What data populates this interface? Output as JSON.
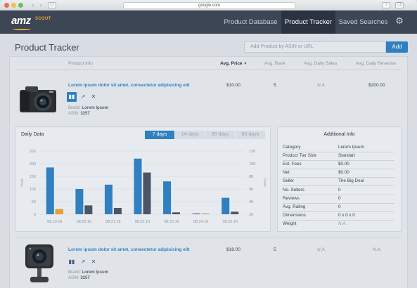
{
  "browser": {
    "url": "google.com"
  },
  "header": {
    "logo_text": "amz",
    "logo_sub": "SCOUT",
    "nav": [
      "Product Database",
      "Product Tracker",
      "Saved Searches"
    ],
    "active_index": 1
  },
  "page": {
    "title": "Product Tracker",
    "add_placeholder": "Add Product by ASIN or URL",
    "add_button": "Add"
  },
  "columns": {
    "product_info": "Product Info",
    "avg_price": "Avg. Price",
    "avg_rank": "Avg. Rank",
    "avg_daily_sales": "Avg. Daily Sales",
    "avg_daily_revenue": "Avg. Daily Revenue"
  },
  "products": [
    {
      "title": "Lorem ipsum dolor sit amet, consectetur adipisicing elit",
      "brand_label": "Brand:",
      "brand": "Lorem Ipsum",
      "asin_label": "ASIN:",
      "asin": "3257",
      "price": "$10.00",
      "rank": "5",
      "sales": "N.A.",
      "revenue": "$200.00"
    },
    {
      "title": "Lorem ipsum dolor sit amet, consectetur adipisicing elit",
      "brand_label": "Brand:",
      "brand": "Lorem Ipsum",
      "asin_label": "ASIN:",
      "asin": "3257",
      "price": "$18.00",
      "rank": "5",
      "sales": "N.A.",
      "revenue": "N.A."
    }
  ],
  "daily": {
    "title": "Daily Data",
    "ranges": [
      "7 days",
      "14 days",
      "30 days",
      "60 days"
    ],
    "active_range": 0
  },
  "chart_data": {
    "type": "bar",
    "categories": [
      "08.19.16",
      "08.20.16",
      "08.21.16",
      "08.22.16",
      "08.23.16",
      "08.24.16",
      "08.25.16"
    ],
    "series": [
      {
        "values": [
          185,
          100,
          117,
          220,
          130,
          0,
          65
        ],
        "axis": "left"
      },
      {
        "values": [
          2800,
          3400,
          3000,
          8600,
          2300,
          0,
          2400
        ],
        "axis": "right"
      },
      {
        "values": [
          20,
          0,
          0,
          0,
          0,
          2,
          0
        ],
        "axis": "left"
      }
    ],
    "ylabel": "Units",
    "ylabel_right": "Rank",
    "ylim": [
      0,
      250
    ],
    "ylim_right": [
      2000,
      12000
    ],
    "yticks": [
      0,
      50,
      100,
      150,
      200,
      250
    ],
    "yticks_right": [
      "2K",
      "4K",
      "6K",
      "8K",
      "10K",
      "12K"
    ],
    "colors": [
      "#2f7fc1",
      "#4a5666",
      "#e8a030"
    ]
  },
  "info": {
    "title": "Additional Info",
    "rows": [
      [
        "Category",
        "Lorem Ipsum"
      ],
      [
        "Product Tier Size",
        "Standart"
      ],
      [
        "Est. Fees",
        "$0.00"
      ],
      [
        "Net",
        "$0.00"
      ],
      [
        "Seller",
        "The Big Deal"
      ],
      [
        "No. Sellers",
        "0"
      ],
      [
        "Reviews",
        "0"
      ],
      [
        "Avg. Rating",
        "0"
      ],
      [
        "Dimensions",
        "0 x 0 x 0"
      ],
      [
        "Weight",
        "N.A."
      ]
    ]
  }
}
